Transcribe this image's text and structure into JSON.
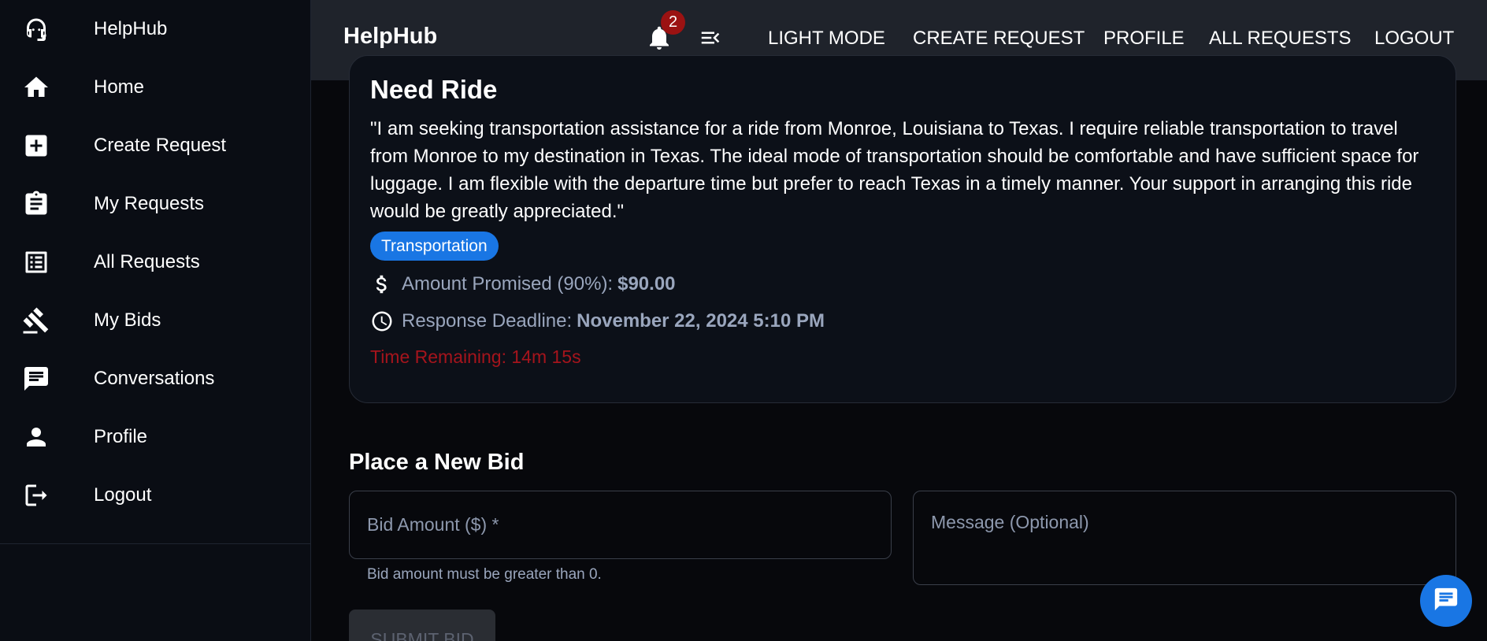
{
  "sidebar": {
    "items": [
      {
        "label": "HelpHub",
        "icon": "headset-icon"
      },
      {
        "label": "Home",
        "icon": "home-icon"
      },
      {
        "label": "Create Request",
        "icon": "add-box-icon"
      },
      {
        "label": "My Requests",
        "icon": "clipboard-icon"
      },
      {
        "label": "All Requests",
        "icon": "list-icon"
      },
      {
        "label": "My Bids",
        "icon": "gavel-icon"
      },
      {
        "label": "Conversations",
        "icon": "chat-icon"
      },
      {
        "label": "Profile",
        "icon": "person-icon"
      },
      {
        "label": "Logout",
        "icon": "logout-icon"
      }
    ]
  },
  "topbar": {
    "brand": "HelpHub",
    "notification_count": "2",
    "nav": [
      "LIGHT MODE",
      "CREATE REQUEST",
      "PROFILE",
      "ALL REQUESTS",
      "LOGOUT"
    ]
  },
  "request": {
    "title": "Need Ride",
    "description": "\"I am seeking transportation assistance for a ride from Monroe, Louisiana to Texas. I require reliable transportation to travel from Monroe to my destination in Texas. The ideal mode of transportation should be comfortable and have sufficient space for luggage. I am flexible with the departure time but prefer to reach Texas in a timely manner. Your support in arranging this ride would be greatly appreciated.\"",
    "category": "Transportation",
    "amount_label": "Amount Promised (90%):",
    "amount_value": "$90.00",
    "deadline_label": "Response Deadline:",
    "deadline_value": "November 22, 2024 5:10 PM",
    "time_remaining": "Time Remaining: 14m 15s"
  },
  "bid_form": {
    "title": "Place a New Bid",
    "amount_placeholder": "Bid Amount ($) *",
    "message_placeholder": "Message (Optional)",
    "helper": "Bid amount must be greater than 0.",
    "submit_label": "SUBMIT BID"
  },
  "colors": {
    "accent": "#1976e4",
    "danger": "#a5141c",
    "badge": "#9b1212"
  }
}
